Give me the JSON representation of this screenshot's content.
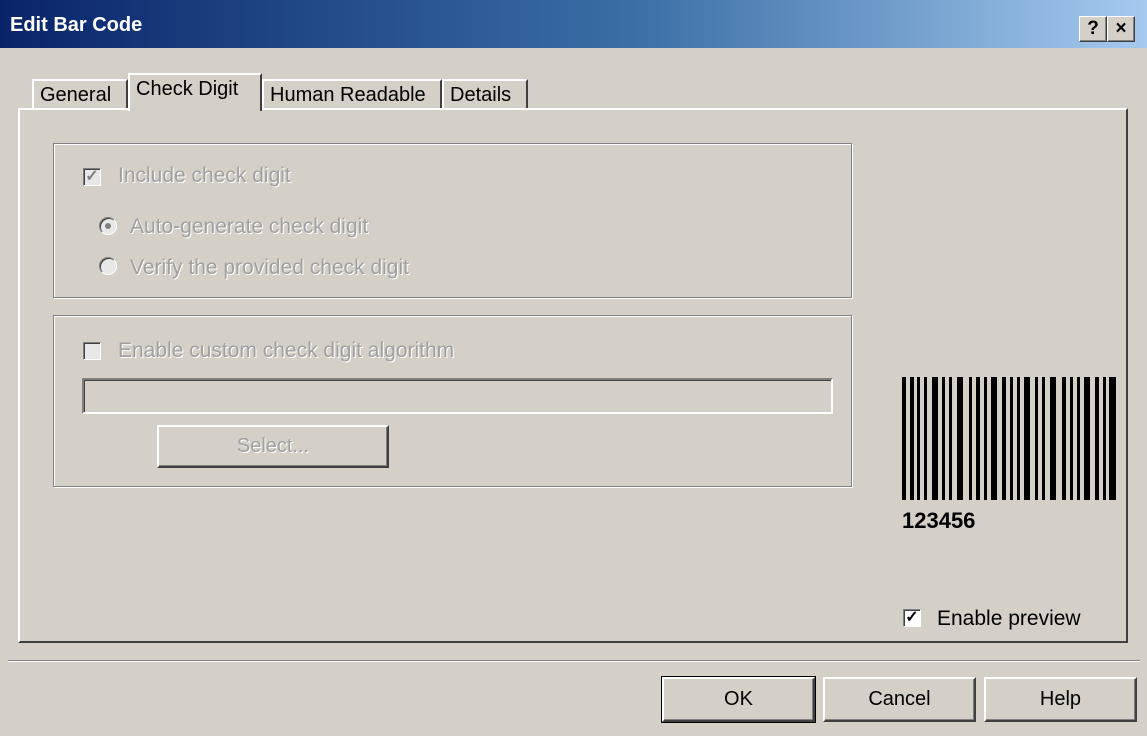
{
  "window": {
    "title": "Edit Bar Code",
    "help_glyph": "?",
    "close_glyph": "×"
  },
  "tabs": [
    "General",
    "Check Digit",
    "Human Readable",
    "Details"
  ],
  "check_digit": {
    "include_label": "Include check digit",
    "auto_label": "Auto-generate check digit",
    "verify_label": "Verify the provided check digit",
    "custom_label": "Enable custom check digit algorithm",
    "algorithm_value": "",
    "select_label": "Select..."
  },
  "preview": {
    "barcode_text": "123456",
    "enable_label": "Enable preview"
  },
  "buttons": {
    "ok": "OK",
    "cancel": "Cancel",
    "help": "Help"
  },
  "state": {
    "include_checked": true,
    "auto_selected": true,
    "custom_checked": false,
    "preview_checked": true
  }
}
